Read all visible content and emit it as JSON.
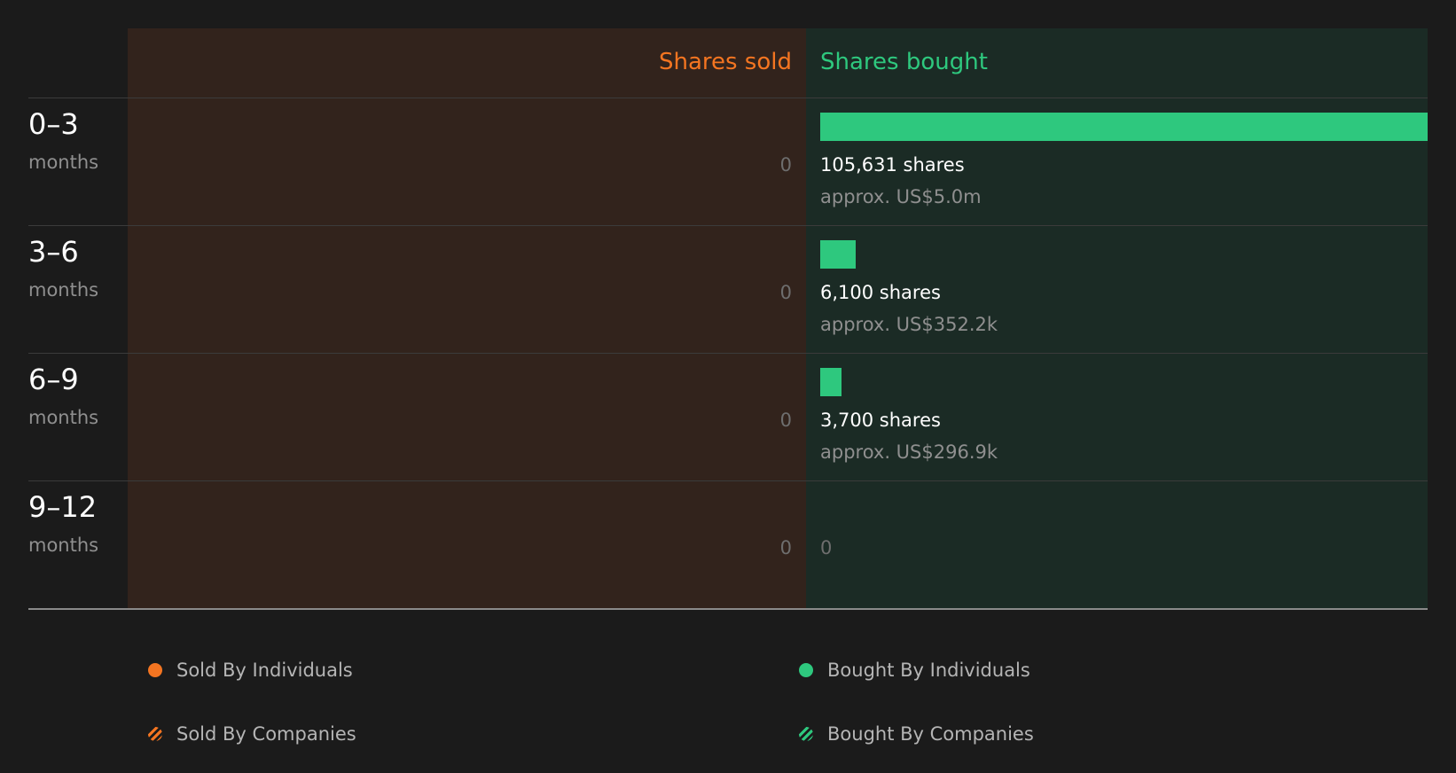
{
  "chart_data": {
    "type": "bar",
    "orientation": "horizontal",
    "categories": [
      "0–3",
      "3–6",
      "6–9",
      "9–12"
    ],
    "category_unit": "months",
    "headers": {
      "sold": "Shares sold",
      "bought": "Shares bought"
    },
    "series": [
      {
        "name": "Shares sold",
        "values": [
          0,
          0,
          0,
          0
        ],
        "value_labels": [
          "0",
          "0",
          "0",
          "0"
        ]
      },
      {
        "name": "Shares bought",
        "values": [
          105631,
          6100,
          3700,
          0
        ],
        "share_labels": [
          "105,631 shares",
          "6,100 shares",
          "3,700 shares",
          ""
        ],
        "value_labels": [
          "approx. US$5.0m",
          "approx. US$352.2k",
          "approx. US$296.9k",
          ""
        ],
        "zero_label": "0"
      }
    ],
    "legend": [
      {
        "label": "Sold By Individuals",
        "color": "#f47521",
        "style": "solid"
      },
      {
        "label": "Sold By Companies",
        "color": "#f47521",
        "style": "hatched"
      },
      {
        "label": "Bought By Individuals",
        "color": "#2ec87e",
        "style": "solid"
      },
      {
        "label": "Bought By Companies",
        "color": "#2ec87e",
        "style": "hatched"
      }
    ],
    "legend_position": "bottom"
  },
  "colors": {
    "sold": "#f47521",
    "bought": "#2ec87e"
  }
}
